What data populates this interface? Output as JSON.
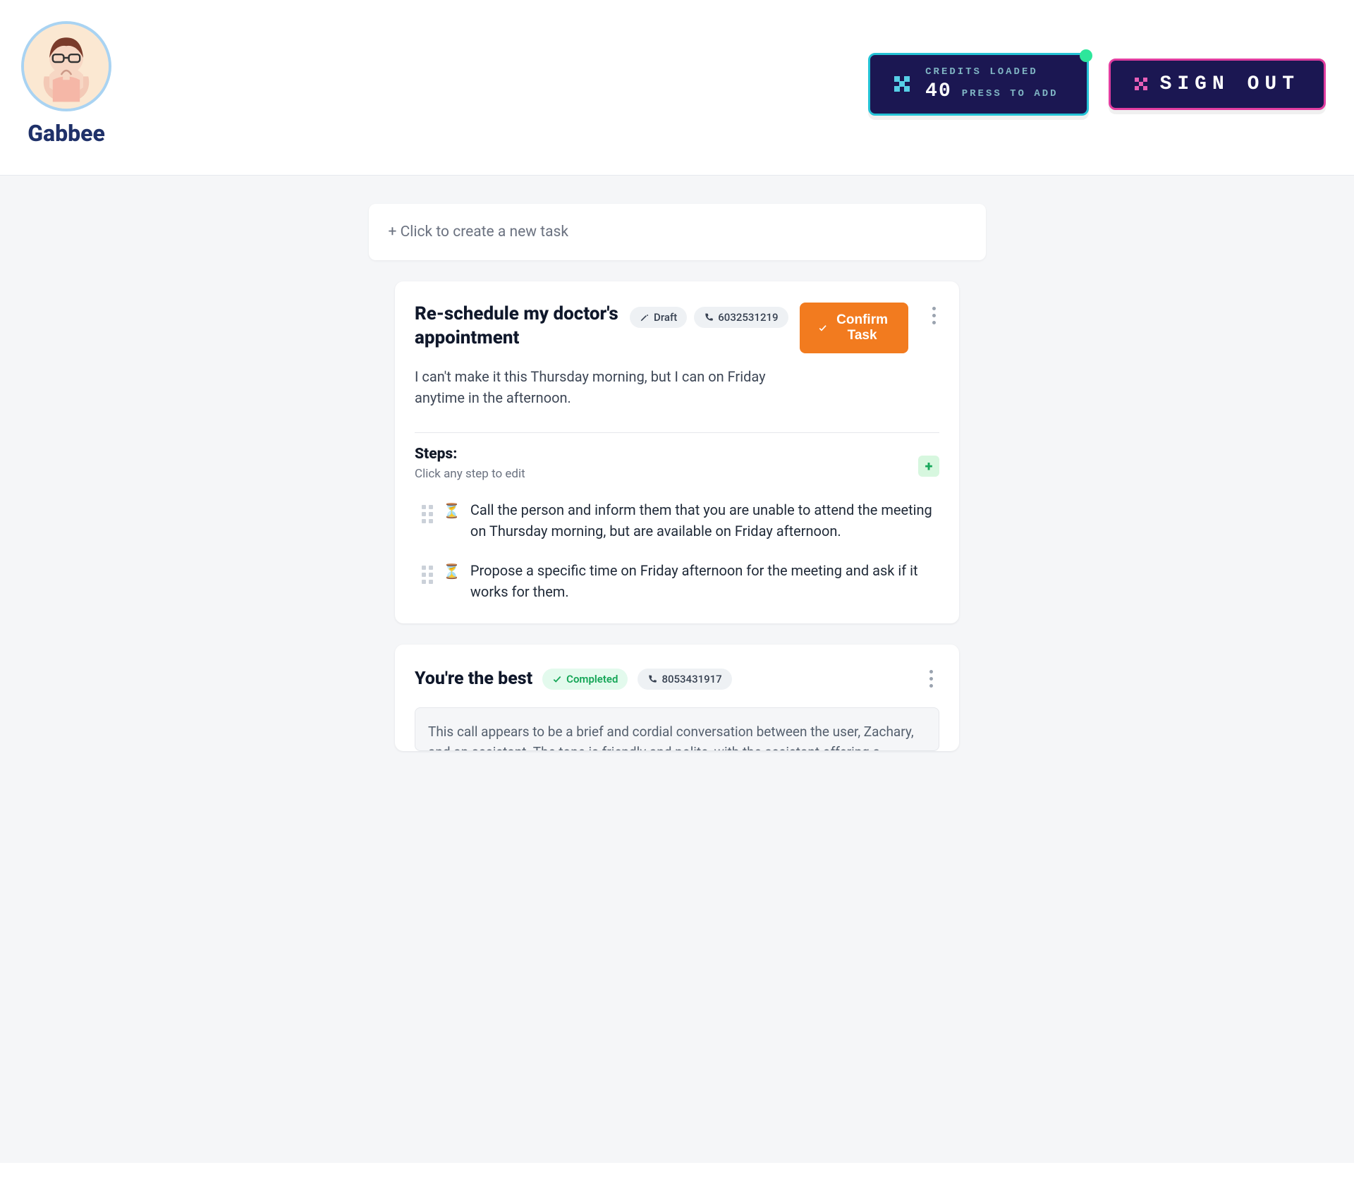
{
  "brand": {
    "name": "Gabbee"
  },
  "header": {
    "credits": {
      "label": "CREDITS LOADED",
      "count": "40",
      "cta": "PRESS TO ADD"
    },
    "signout_label": "SIGN OUT"
  },
  "new_task": {
    "prompt": "+ Click to create a new task"
  },
  "tasks": [
    {
      "title": "Re-schedule my doctor's appointment",
      "status_label": "Draft",
      "phone": "6032531219",
      "confirm_label": "Confirm Task",
      "description": "I can't make it this Thursday morning, but I can on Friday anytime in the afternoon.",
      "steps_heading": "Steps:",
      "steps_sub": "Click any step to edit",
      "steps": [
        "Call the person and inform them that you are unable to attend the meeting on Thursday morning, but are available on Friday afternoon.",
        "Propose a specific time on Friday afternoon for the meeting and ask if it works for them."
      ]
    },
    {
      "title": "You're the best",
      "status_label": "Completed",
      "phone": "8053431917",
      "summary": "This call appears to be a brief and cordial conversation between the user, Zachary, and an assistant. The tone is friendly and polite, with the assistant offering a compliment to"
    }
  ]
}
